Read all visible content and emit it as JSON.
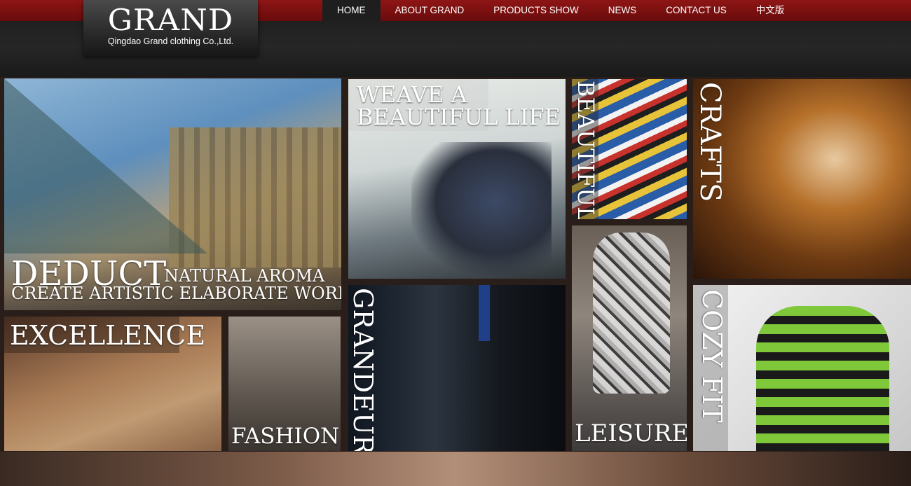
{
  "logo": {
    "title": "GRAND",
    "subtitle": "Qingdao Grand clothing Co.,Ltd."
  },
  "nav": {
    "items": [
      {
        "label": "HOME",
        "active": true
      },
      {
        "label": "ABOUT GRAND",
        "active": false
      },
      {
        "label": "PRODUCTS SHOW",
        "active": false
      },
      {
        "label": "NEWS",
        "active": false
      },
      {
        "label": "CONTACT US",
        "active": false
      },
      {
        "label": "中文版",
        "active": false
      }
    ]
  },
  "tiles": {
    "deduct": {
      "headline": "DEDUCT",
      "line1": "NATURAL AROMA",
      "line2": "CREATE ARTISTIC ELABORATE WORKS"
    },
    "weave": {
      "line1": "WEAVE A",
      "line2": "BEAUTIFUL LIFE"
    },
    "beautiful": {
      "label": "BEAUTIFUL"
    },
    "crafts": {
      "label": "CRAFTS"
    },
    "excellence": {
      "label": "EXCELLENCE"
    },
    "fashion": {
      "label": "FASHION"
    },
    "grandeur": {
      "label": "GRANDEUR"
    },
    "leisure": {
      "label": "LEISURE"
    },
    "cozy": {
      "label": "COZY FIT"
    }
  },
  "colors": {
    "nav_bar": "#8e1515",
    "nav_active": "#1e1e1e",
    "text": "#ffffff"
  }
}
